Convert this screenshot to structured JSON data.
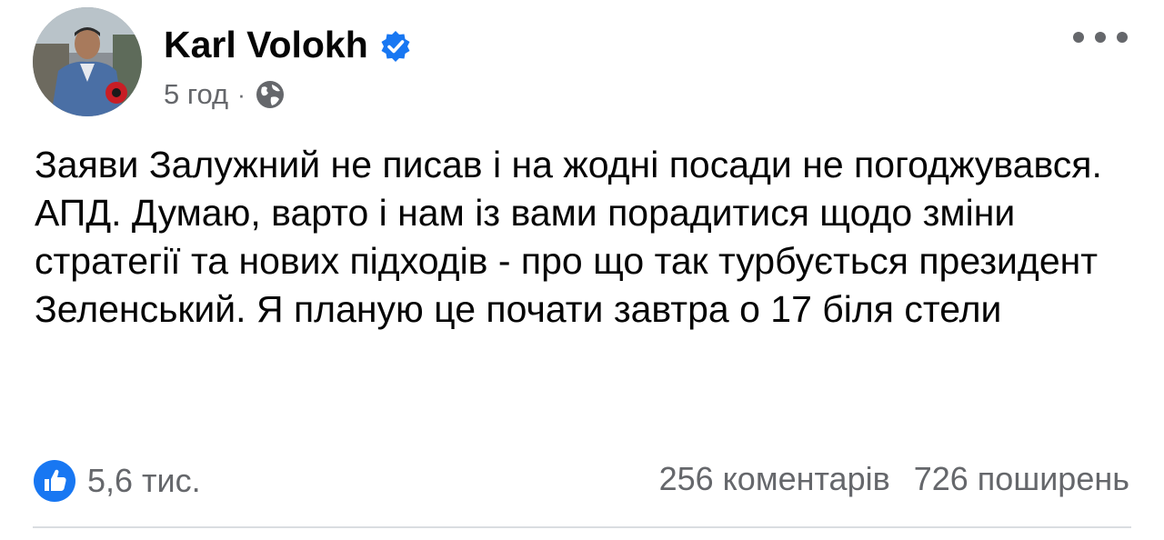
{
  "post": {
    "author": "Karl Volokh",
    "time": "5 год",
    "separator": "·",
    "paragraphs": [
      "Заяви Залужний не писав і на жодні посади не погоджувався.",
      "АПД. Думаю, варто і нам із вами порадитися щодо зміни стратегії та нових підходів - про що так турбується президент Зеленський. Я планую це почати завтра о 17 біля стели"
    ]
  },
  "engagement": {
    "likes": "5,6 тис.",
    "comments": "256 коментарів",
    "shares": "726 поширень"
  },
  "colors": {
    "primary_text": "#050505",
    "secondary_text": "#65676b",
    "accent_blue": "#1877f2",
    "divider": "#dadde1"
  },
  "icons": [
    "verified-badge-icon",
    "globe-icon",
    "more-options-icon",
    "like-reaction-icon"
  ]
}
